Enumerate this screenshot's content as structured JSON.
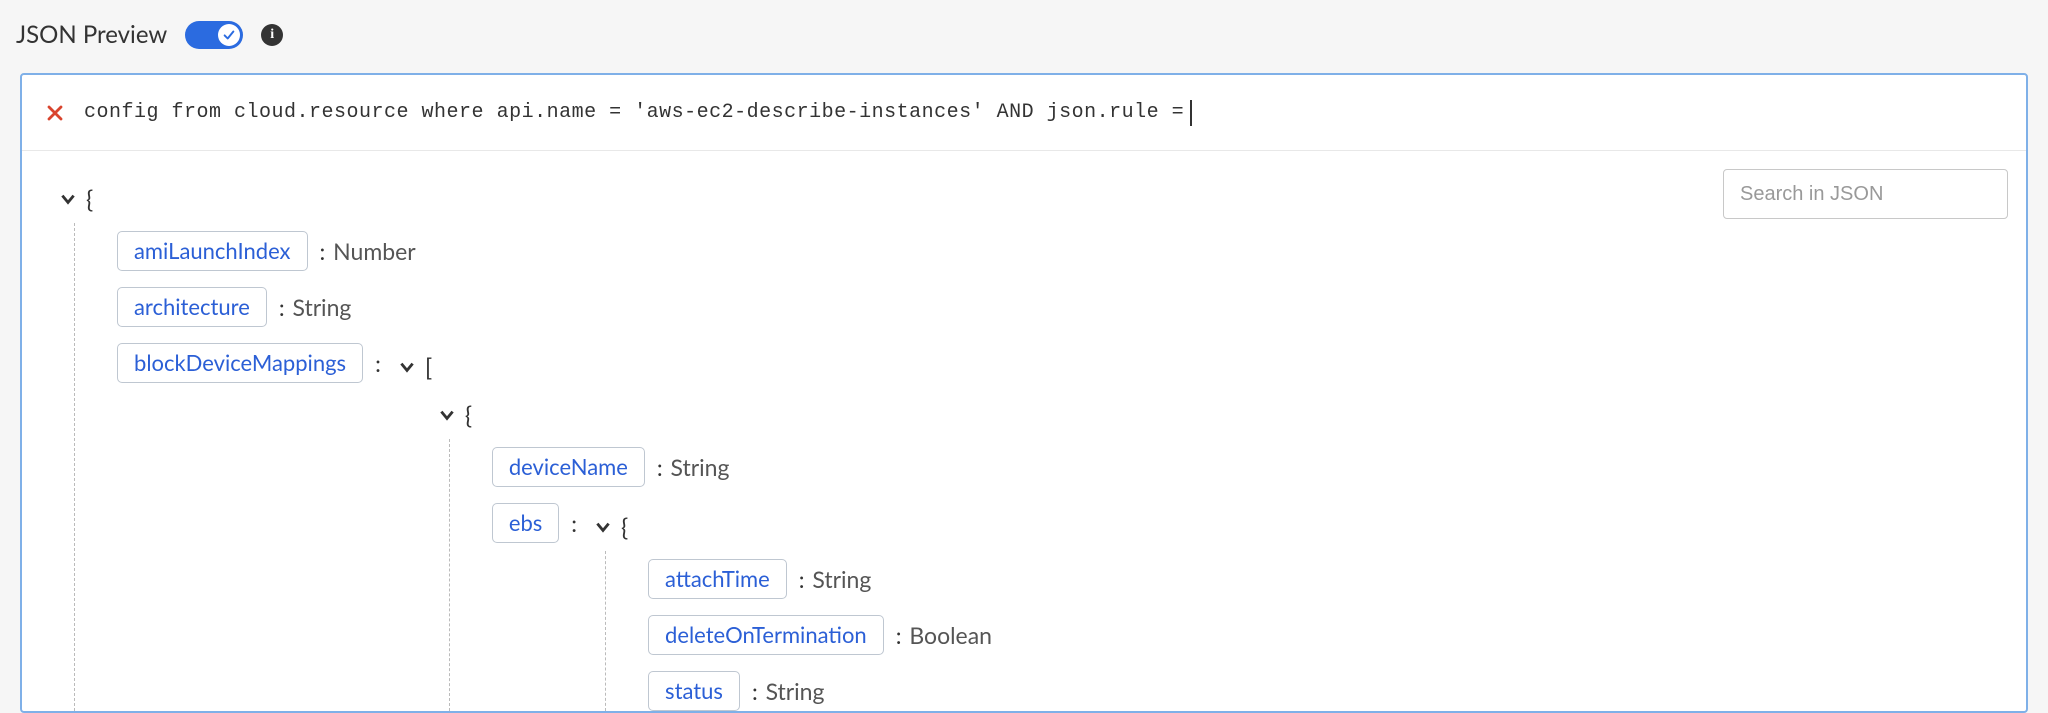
{
  "header": {
    "title": "JSON Preview",
    "toggle_on": true
  },
  "query": {
    "text": "config from cloud.resource where api.name = 'aws-ec2-describe-instances' AND json.rule = "
  },
  "search": {
    "placeholder": "Search in JSON"
  },
  "brace_open": "{",
  "brace_close": "}",
  "bracket_open": "[",
  "colon": ":",
  "tree": {
    "p1": {
      "key": "amiLaunchIndex",
      "type": "Number"
    },
    "p2": {
      "key": "architecture",
      "type": "String"
    },
    "p3": {
      "key": "blockDeviceMappings"
    },
    "p3_items": {
      "p1": {
        "key": "deviceName",
        "type": "String"
      },
      "p2": {
        "key": "ebs"
      },
      "p2_items": {
        "p1": {
          "key": "attachTime",
          "type": "String"
        },
        "p2": {
          "key": "deleteOnTermination",
          "type": "Boolean"
        },
        "p3": {
          "key": "status",
          "type": "String"
        }
      }
    }
  }
}
